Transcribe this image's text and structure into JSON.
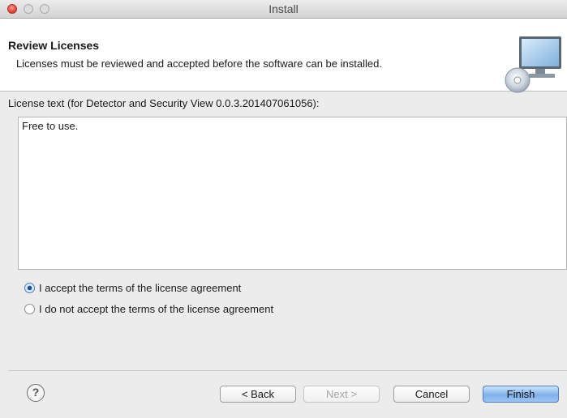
{
  "window": {
    "title": "Install"
  },
  "header": {
    "title": "Review Licenses",
    "description": "Licenses must be reviewed and accepted before the software can be installed.",
    "icon": "install-disc-monitor-icon"
  },
  "license": {
    "label": "License text (for Detector and Security View 0.0.3.201407061056):",
    "text": "Free to use."
  },
  "options": {
    "accept_label": "I accept the terms of the license agreement",
    "decline_label": "I do not accept the terms of the license agreement",
    "selected": "accept"
  },
  "buttons": {
    "help": "?",
    "back": "< Back",
    "next": "Next >",
    "cancel": "Cancel",
    "finish": "Finish"
  },
  "colors": {
    "accent": "#7fb1ea",
    "close": "#e0443a"
  }
}
